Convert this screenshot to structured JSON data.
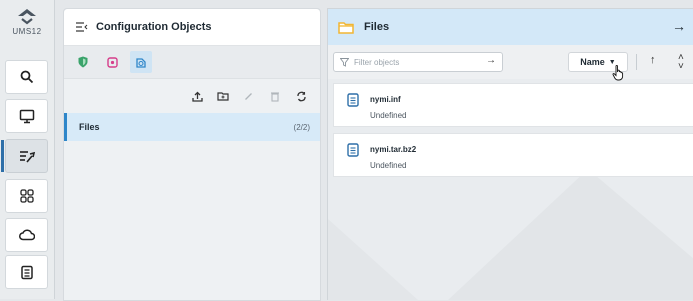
{
  "rail": {
    "logo_text": "UMS12",
    "items": [
      {
        "name": "search"
      },
      {
        "name": "devices"
      },
      {
        "name": "configuration"
      },
      {
        "name": "apps"
      },
      {
        "name": "cloud"
      },
      {
        "name": "documents"
      }
    ]
  },
  "config_panel": {
    "title": "Configuration Objects",
    "tabs": [
      {
        "name": "shield-tab",
        "color": "#3aa36b"
      },
      {
        "name": "device-tab",
        "color": "#d63d8a"
      },
      {
        "name": "files-tab",
        "color": "#2e86c9"
      }
    ],
    "tree": {
      "label": "Files",
      "count": "(2/2)"
    }
  },
  "files_panel": {
    "title": "Files",
    "filter_placeholder": "Filter objects",
    "sort_label": "Name",
    "items": [
      {
        "name": "nymi.inf",
        "status": "Undefined"
      },
      {
        "name": "nymi.tar.bz2",
        "status": "Undefined"
      }
    ]
  },
  "colors": {
    "accent": "#2e86c9",
    "folder": "#f2b632",
    "selected_row": "#d7eaf8",
    "header_right": "#d3e8f8"
  }
}
